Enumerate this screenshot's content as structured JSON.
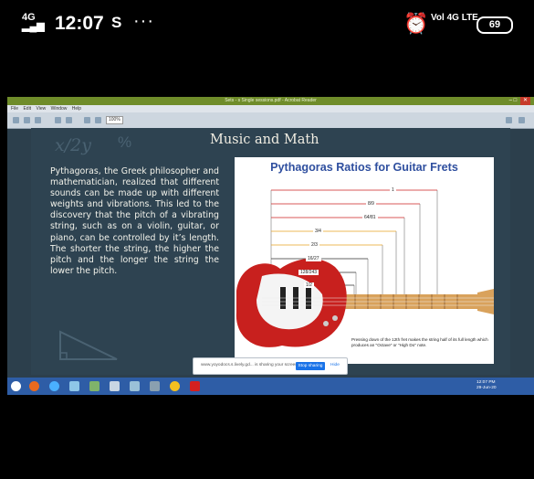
{
  "status_bar": {
    "signal_label": "4G",
    "time": "12:07",
    "sim_icon": "S",
    "more_label": "···",
    "alarm_icon": "alarm-clock",
    "net_label": "Vol 4G LTE",
    "battery": "69"
  },
  "window": {
    "title": "Sets - s Single sessions.pdf - Acrobat Reader",
    "menu_items": [
      "File",
      "Edit",
      "View",
      "Window",
      "Help"
    ],
    "zoom": "100%"
  },
  "slide": {
    "formula": "x/2y",
    "percent": "%",
    "title": "Music and Math",
    "body": "Pythagoras, the Greek philosopher and mathematician, realized that different sounds can be made up with different weights and vibrations. This led to the discovery that the pitch of a vibrating string, such as on a violin, guitar, or piano, can be controlled by it’s length. The shorter the string, the higher the pitch and the longer the string the lower the pitch."
  },
  "guitar_image": {
    "title": "Pythagoras Ratios for Guitar Frets",
    "ratios": [
      "1",
      "8/9",
      "64/81",
      "3/4",
      "2/3",
      "16/27",
      "128/243",
      "1/2"
    ],
    "caption": "Pressing down of the 12th fret makes the string half of its full length which produces an \"Octave\" or \"High Do\" note.",
    "colors": {
      "body": "#c8201e",
      "pickguard": "#ffffff",
      "neck": "#d9a25c",
      "title": "#2f4f9f"
    }
  },
  "share_bar": {
    "text": "www.yoyodocs.s.lively.gd... is sharing your screen.",
    "share_label": "Stop sharing",
    "hide_label": "Hide"
  },
  "taskbar": {
    "icons": [
      "start",
      "firefox",
      "ie",
      "explorer",
      "files",
      "mail",
      "games",
      "vlc",
      "chrome",
      "acrobat"
    ],
    "time": "12:07 PM",
    "date": "29-Jun-20"
  }
}
